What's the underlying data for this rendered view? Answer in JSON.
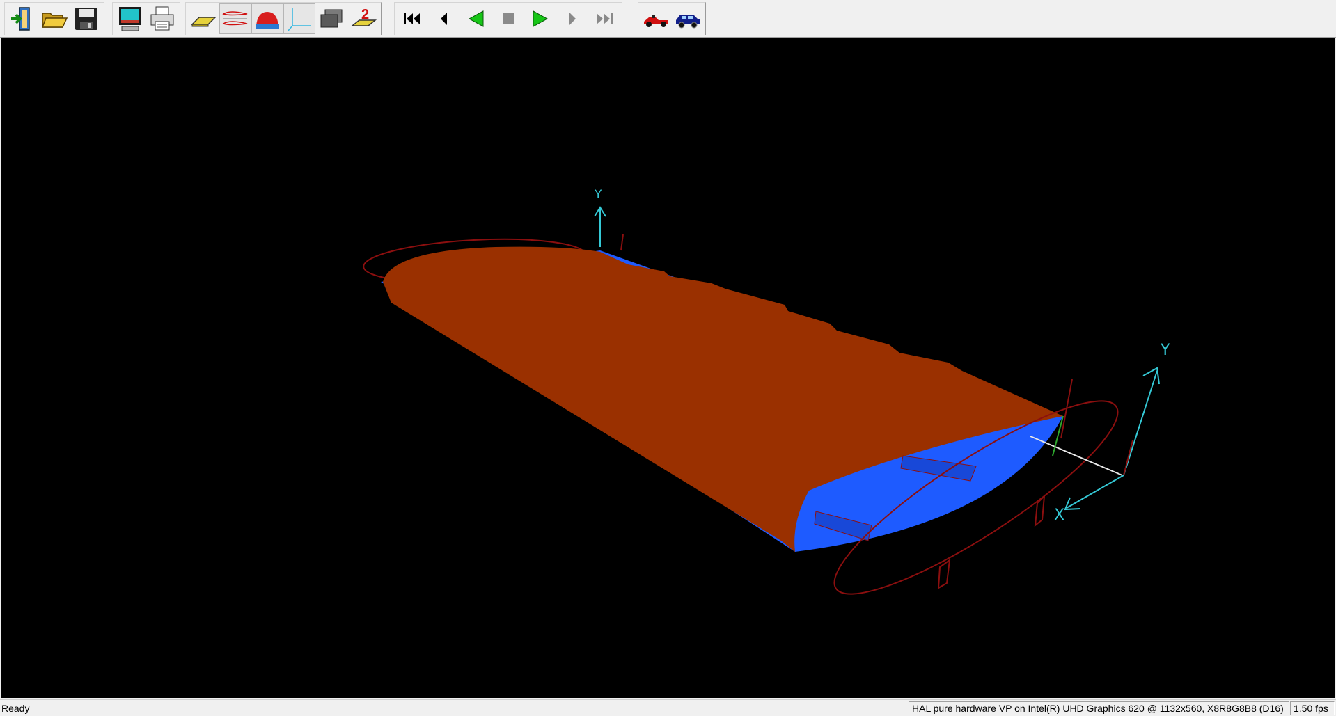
{
  "toolbar": {
    "groups": [
      [
        "exit-icon",
        "open-folder-icon",
        "save-disk-icon"
      ],
      [
        "screenshot-icon",
        "print-icon"
      ],
      [
        "wing-plane-icon",
        "airfoil-icon",
        "body-icon",
        "axes-icon",
        "layers-icon",
        "step-two-icon"
      ],
      [
        "first-frame-icon",
        "prev-frame-icon",
        "play-backward-icon",
        "stop-icon",
        "play-forward-icon",
        "next-frame-icon",
        "last-frame-icon"
      ],
      [
        "race-car-icon",
        "car-icon"
      ]
    ],
    "pressed": [
      "airfoil-icon",
      "body-icon",
      "axes-icon"
    ]
  },
  "viewport": {
    "background": "#000000",
    "colors": {
      "wing_top": "#9a3000",
      "wing_bottom": "#1e5bff",
      "axis_y": "#35c9d6",
      "axis_x": "#8b0f0f",
      "axis_z": "#2ea82e",
      "chord_line": "#e8e8e8"
    },
    "axis_labels": {
      "y": "Y",
      "x": "X"
    }
  },
  "status": {
    "ready": "Ready",
    "renderer": "HAL pure hardware VP on Intel(R) UHD Graphics 620 @ 1132x560, X8R8G8B8 (D16)",
    "fps": "1.50 fps"
  }
}
